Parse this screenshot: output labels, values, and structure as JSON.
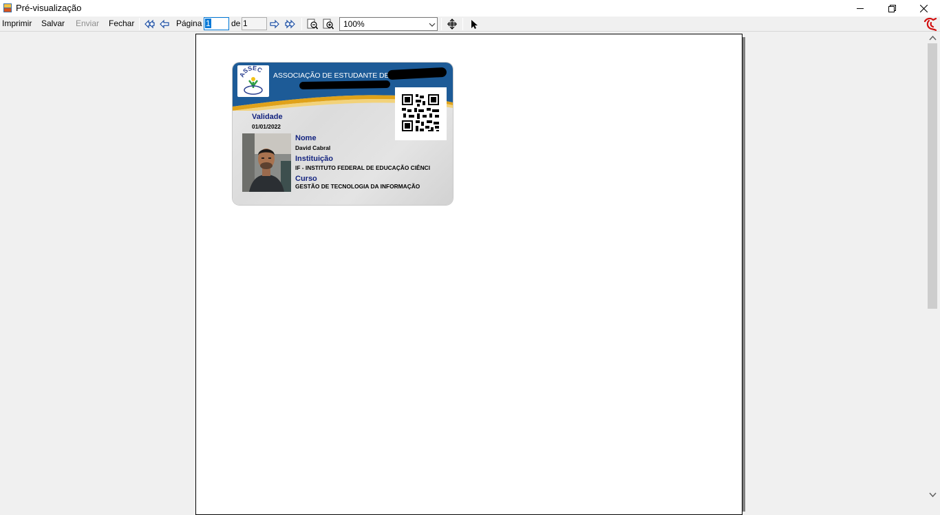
{
  "window": {
    "title": "Pré-visualização"
  },
  "toolbar": {
    "print_label": "Imprimir",
    "save_label": "Salvar",
    "send_label": "Enviar",
    "close_label": "Fechar",
    "page_label": "Página",
    "page_value": "1",
    "of_label": "de",
    "page_total": "1",
    "zoom_value": "100%"
  },
  "card": {
    "logo_text": "ASSEC",
    "association": "ASSOCIAÇÃO DE ESTUDANTE DE",
    "validity_label": "Validade",
    "validity_value": "01/01/2022",
    "name_label": "Nome",
    "name_value": "David Cabral",
    "institution_label": "Instituição",
    "institution_value": "IF - INSTITUTO FEDERAL DE EDUCAÇÃO CIÊNCI",
    "course_label": "Curso",
    "course_value": "GESTÃO DE TECNOLOGIA DA INFORMAÇÃO"
  },
  "colors": {
    "card_band": "#1d5b97",
    "card_stripe": "#e0a21a",
    "label_blue": "#13237f",
    "selection": "#0078d7"
  }
}
